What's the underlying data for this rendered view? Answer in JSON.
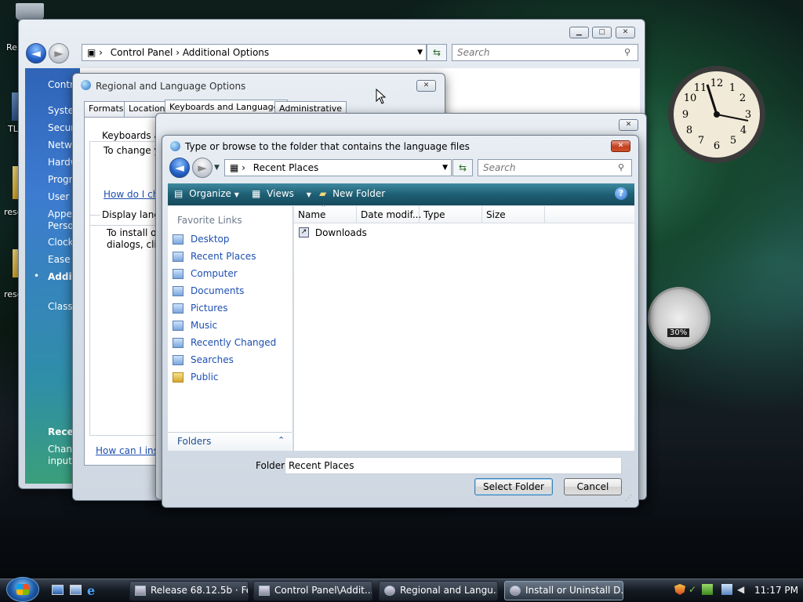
{
  "desktop": {
    "icons": [
      {
        "label": "Re"
      },
      {
        "label": "TL"
      },
      {
        "label": "resc"
      },
      {
        "label": "resc"
      }
    ]
  },
  "control_panel": {
    "breadcrumb": [
      "Control Panel",
      "Additional Options"
    ],
    "search_placeholder": "Search",
    "sidebar": [
      "Contro",
      "System",
      "Securi",
      "Netwo",
      "Hardw",
      "Progra",
      "User A",
      "Appea",
      "Person",
      "Clock,",
      "Ease o",
      "Additi",
      "Classic"
    ],
    "recent": {
      "heading": "Recen",
      "line1": "Chang",
      "line2": "input"
    }
  },
  "regional": {
    "title": "Regional and Language Options",
    "tabs": [
      "Formats",
      "Location",
      "Keyboards and Languages",
      "Administrative"
    ],
    "group1": {
      "label": "Keyboards an",
      "text": "To change yo",
      "link": "How do I cha"
    },
    "group2": {
      "label": "Display langu",
      "line1": "To install or",
      "line2": "dialogs, clic"
    },
    "bottom_link": "How can I inst"
  },
  "install_window": {
    "title": "Install or Uninstall D..."
  },
  "dialog": {
    "title": "Type or browse to the folder that contains the language files",
    "address": "Recent Places",
    "search_placeholder": "Search",
    "toolbar": {
      "organize": "Organize",
      "views": "Views",
      "new_folder": "New Folder"
    },
    "favorite_links_heading": "Favorite Links",
    "favorites": [
      {
        "label": "Desktop",
        "icon": "desktop-icon"
      },
      {
        "label": "Recent Places",
        "icon": "recent-places-icon"
      },
      {
        "label": "Computer",
        "icon": "computer-icon"
      },
      {
        "label": "Documents",
        "icon": "documents-icon"
      },
      {
        "label": "Pictures",
        "icon": "pictures-icon"
      },
      {
        "label": "Music",
        "icon": "music-icon"
      },
      {
        "label": "Recently Changed",
        "icon": "recently-changed-icon"
      },
      {
        "label": "Searches",
        "icon": "searches-icon"
      },
      {
        "label": "Public",
        "icon": "public-folder-icon"
      }
    ],
    "folders_label": "Folders",
    "columns": [
      "Name",
      "Date modif...",
      "Type",
      "Size"
    ],
    "files": [
      {
        "name": "Downloads"
      }
    ],
    "folder_label": "Folder:",
    "folder_value": "Recent Places",
    "select_button": "Select Folder",
    "cancel_button": "Cancel"
  },
  "gadgets": {
    "clock_numbers": [
      "12",
      "1",
      "2",
      "3",
      "4",
      "5",
      "6",
      "7",
      "8",
      "9",
      "10",
      "11"
    ],
    "cpu_percent": "30%"
  },
  "taskbar": {
    "tasks": [
      "Release 68.12.5b · Fe...",
      "Control Panel\\Addit...",
      "Regional and Langu...",
      "Install or Uninstall D..."
    ],
    "time": "11:17 PM"
  },
  "colors": {
    "accent_blue": "#1d4fb0",
    "toolbar_teal": "#1f5f74",
    "taskbar": "#1b222b"
  }
}
